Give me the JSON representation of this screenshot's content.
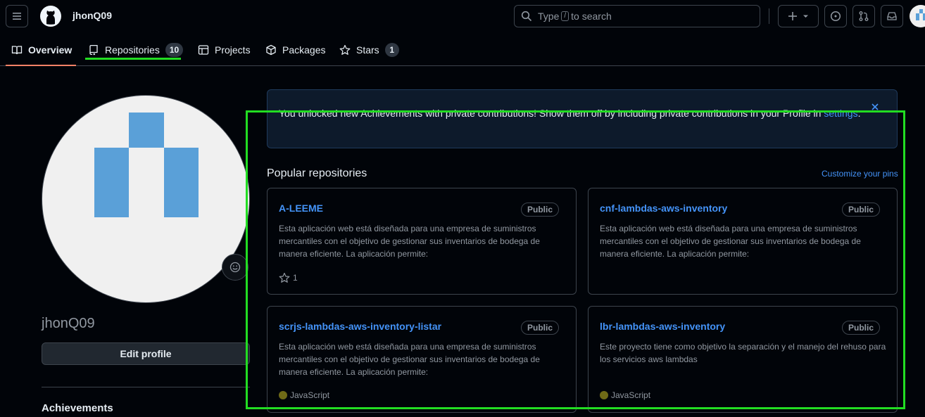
{
  "header": {
    "username": "jhonQ09",
    "search_prefix": "Type",
    "search_key": "/",
    "search_suffix": "to search"
  },
  "tabs": [
    {
      "label": "Overview",
      "counter": null
    },
    {
      "label": "Repositories",
      "counter": "10"
    },
    {
      "label": "Projects",
      "counter": null
    },
    {
      "label": "Packages",
      "counter": null
    },
    {
      "label": "Stars",
      "counter": "1"
    }
  ],
  "sidebar": {
    "name": "jhonQ09",
    "edit_profile_label": "Edit profile",
    "achievements_label": "Achievements"
  },
  "flash": {
    "message": "You unlocked new Achievements with private contributions! Show them off by including private contributions in your Profile in",
    "link": "settings",
    "end": "."
  },
  "popular": {
    "title": "Popular repositories",
    "customize_label": "Customize your pins",
    "repos": [
      {
        "name": "A-LEEME",
        "visibility": "Public",
        "description": "Esta aplicación web está diseñada para una empresa de suministros mercantiles con el objetivo de gestionar sus inventarios de bodega de manera eficiente. La aplicación permite:",
        "stars": "1",
        "language": ""
      },
      {
        "name": "cnf-lambdas-aws-inventory",
        "visibility": "Public",
        "description": "Esta aplicación web está diseñada para una empresa de suministros mercantiles con el objetivo de gestionar sus inventarios de bodega de manera eficiente. La aplicación permite:",
        "stars": "",
        "language": ""
      },
      {
        "name": "scrjs-lambdas-aws-inventory-listar",
        "visibility": "Public",
        "description": "Esta aplicación web está diseñada para una empresa de suministros mercantiles con el objetivo de gestionar sus inventarios de bodega de manera eficiente. La aplicación permite:",
        "stars": "",
        "language": "JavaScript"
      },
      {
        "name": "lbr-lambdas-aws-inventory",
        "visibility": "Public",
        "description": "Este proyecto tiene como objetivo la separación y el manejo del rehuso para los servicios aws lambdas",
        "stars": "",
        "language": "JavaScript"
      }
    ]
  },
  "colors": {
    "accent_link": "#4493f8",
    "highlight": "#22dd22",
    "tab_active": "#f78166",
    "javascript": "#6f6a17"
  }
}
